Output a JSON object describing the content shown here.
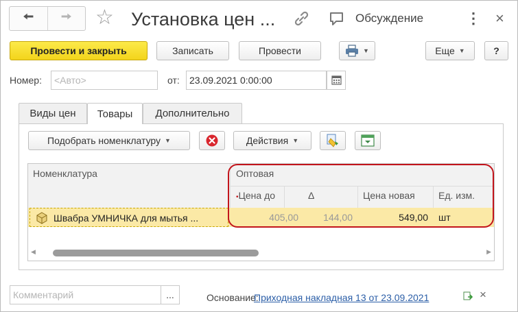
{
  "header": {
    "back_icon": "arrow-left-icon",
    "forward_icon": "arrow-right-icon",
    "favorite_icon": "star-icon",
    "title": "Установка цен ...",
    "link_icon": "link-icon",
    "discussion_label": "Обсуждение",
    "more_icon": "vertical-dots-icon",
    "close_icon": "close-icon"
  },
  "toolbar": {
    "post_close_label": "Провести и закрыть",
    "write_label": "Записать",
    "post_label": "Провести",
    "print_icon": "printer-icon",
    "more_label": "Еще",
    "help_label": "?"
  },
  "form": {
    "number_label": "Номер:",
    "number_placeholder": "<Авто>",
    "date_label": "от:",
    "date_value": "23.09.2021  0:00:00",
    "calendar_icon": "calendar-icon"
  },
  "tabs": [
    "Виды цен",
    "Товары",
    "Дополнительно"
  ],
  "goods_toolbar": {
    "pick_label": "Подобрать номенклатуру",
    "delete_icon": "delete-icon",
    "actions_label": "Действия"
  },
  "table": {
    "col_item": "Номенклатура",
    "group_label": "Оптовая",
    "col_price_before": "Цена до",
    "col_delta": "Δ",
    "col_price_new": "Цена новая",
    "col_unit": "Ед. изм.",
    "rows": [
      {
        "item": "Швабра УМНИЧКА для мытья ...",
        "price_before": "405,00",
        "delta": "144,00",
        "price_new": "549,00",
        "unit": "шт"
      }
    ]
  },
  "footer": {
    "comment_placeholder": "Комментарий",
    "ellipsis": "...",
    "basis_label": "Основание:",
    "basis_link": "Приходная накладная 13 от 23.09.2021"
  },
  "colors": {
    "primary_button": "#f3d41b",
    "highlight_border": "#c2141b",
    "selected_row": "#fbe9a6",
    "link": "#2b5ea7"
  }
}
